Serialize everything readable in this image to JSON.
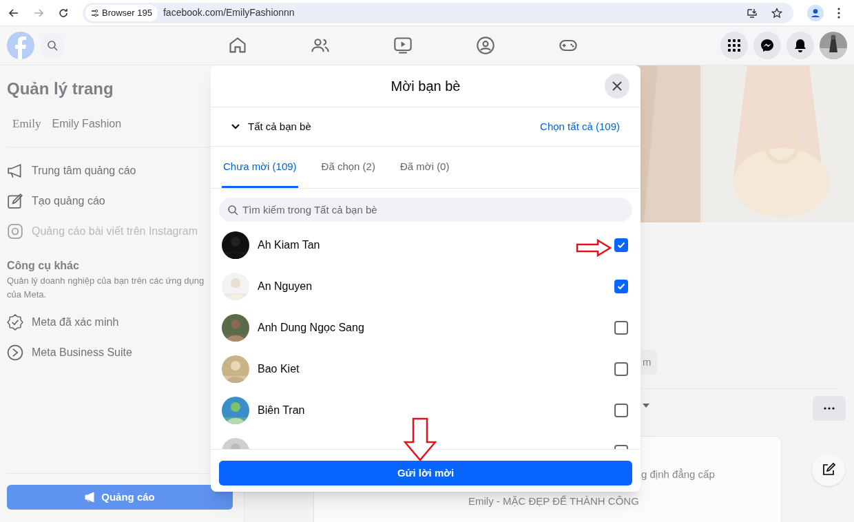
{
  "browser": {
    "site_chip": "Browser 195",
    "url": "facebook.com/EmilyFashionnn"
  },
  "sidebar": {
    "title": "Quản lý trang",
    "page_logo": "Emily",
    "page_name": "Emily Fashion",
    "items": [
      {
        "kind": "megaphone",
        "label": "Trung tâm quảng cáo",
        "disabled": false
      },
      {
        "kind": "edit",
        "label": "Tạo quảng cáo",
        "disabled": false
      },
      {
        "kind": "instagram",
        "label": "Quảng cáo bài viết trên Instagram",
        "disabled": true
      }
    ],
    "section_title": "Công cụ khác",
    "section_text": "Quản lý doanh nghiệp của bạn trên các ứng dụng của Meta.",
    "tools": [
      {
        "kind": "verified",
        "label": "Meta đã xác minh"
      },
      {
        "kind": "suite",
        "label": "Meta Business Suite"
      }
    ],
    "ad_button": "Quảng cáo"
  },
  "main": {
    "button_fragment": "m",
    "post_text": "g định đẳng cấp",
    "post_caption": "Emily - MẶC ĐẸP ĐỂ THÀNH CÔNG"
  },
  "dialog": {
    "title": "Mời bạn bè",
    "filter": "Tất cả bạn bè",
    "select_all": "Chọn tất cả (109)",
    "tabs": [
      {
        "label": "Chưa mời (109)",
        "selected": true
      },
      {
        "label": "Đã chọn (2)",
        "selected": false
      },
      {
        "label": "Đã mời (0)",
        "selected": false
      }
    ],
    "search_placeholder": "Tìm kiếm trong Tất cả bạn bè",
    "friends": [
      {
        "name": "Ah Kiam Tan",
        "checked": true
      },
      {
        "name": "An Nguyen",
        "checked": true
      },
      {
        "name": "Anh Dung Ngọc Sang",
        "checked": false
      },
      {
        "name": "Bao Kiet",
        "checked": false
      },
      {
        "name": "Biên Tran",
        "checked": false
      },
      {
        "checked": false
      }
    ],
    "submit": "Gửi lời mời"
  }
}
